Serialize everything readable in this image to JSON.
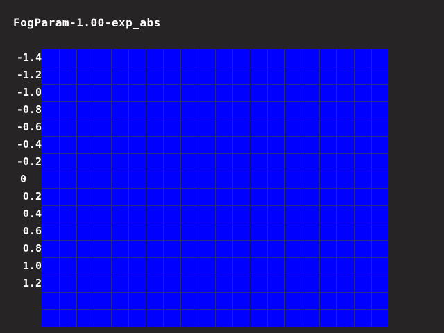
{
  "title": "FogParam-1.00-exp_abs",
  "grid": {
    "fill_color": "#0000ff",
    "line_color": "#2a2a80",
    "columns": 20,
    "rows": 16
  },
  "y_labels": [
    "-1.4",
    "-1.2",
    "-1.0",
    "-0.8",
    "-0.6",
    "-0.4",
    "-0.2",
    "0",
    "0.2",
    "0.4",
    "0.6",
    "0.8",
    "1.0",
    "1.2"
  ],
  "background_color": "#262424"
}
